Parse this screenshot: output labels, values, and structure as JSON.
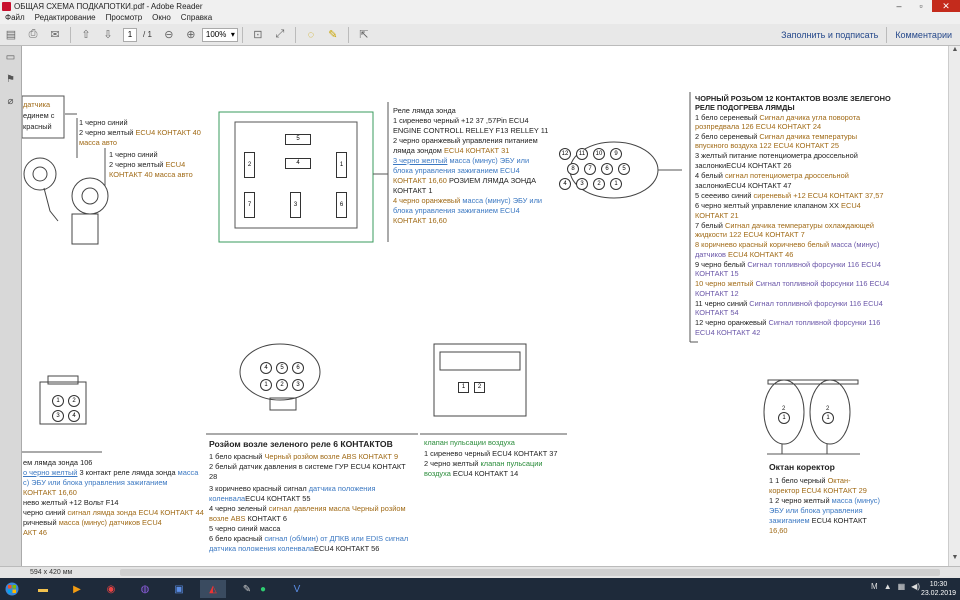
{
  "window": {
    "title": "ОБЩАЯ СХЕМА ПОДКАПОТКИ.pdf - Adobe Reader"
  },
  "menu": [
    "Файл",
    "Редактирование",
    "Просмотр",
    "Окно",
    "Справка"
  ],
  "toolbar": {
    "page_current": "1",
    "page_total": "/ 1",
    "zoom": "100%",
    "fill_sign": "Заполнить и подписать",
    "comments": "Комментарии"
  },
  "status": {
    "page_size": "594 x 420 мм"
  },
  "clock": {
    "time": "10:30",
    "date": "23.02.2019"
  },
  "doc": {
    "tl_box": {
      "l1": "датчика",
      "l2": "единем с",
      "l3": "красный"
    },
    "tl_a": {
      "l1": "1 черно синий",
      "l2a": "2 черно желтый ",
      "l2b": "ECU4 КОНТАКТ 40",
      "l3": "масса авто"
    },
    "tl_b": {
      "l1": "1 черно синий",
      "l2a": "2 черно желтый ",
      "l2b": "ECU4",
      "l3a": "КОНТАКТ 40 ",
      "l3b": "масса авто"
    },
    "rel6": {
      "pins": [
        "5",
        "2",
        "4",
        "1",
        "7",
        "3",
        "6"
      ]
    },
    "lambda": {
      "l1": "Реле лямда зонда",
      "l2": "1  сиренево черный  +12 37 ,57Pin ECU4",
      "l3": "ENGINE CONTROLL RELLEY F13 RELLEY 11",
      "l4": "2 черно оранжевый управления питанием",
      "l5a": "лямда зондом ",
      "l5b": "ECU4 КОНТАКТ 31",
      "l6a": "3 черно желтый",
      "l6b": "  масса (минус) ЭБУ или",
      "l7": "блока управления зажиганием ECU4",
      "l8a": "КОНТАКТ 16,60 ",
      "l8b": "РОЗИЕМ ЛЯМДА ЗОНДА",
      "l9": "КОНТАКТ 1",
      "l10a": "4 черно оранжевый ",
      "l10b": "масса (минус) ЭБУ или",
      "l11": "блока управления зажиганием ECU4",
      "l12": "КОНТАКТ 16,60"
    },
    "conn12": {
      "top": [
        "12",
        "11",
        "10",
        "9"
      ],
      "mid": [
        "8",
        "7",
        "6",
        "5"
      ],
      "bot": [
        "4",
        "3",
        "2",
        "1"
      ]
    },
    "black12": {
      "h1": "ЧОРНЫЙ РОЗЬОМ 12 КОНТАКТОВ ВОЗЛЕ ЗЕЛЕГОНО",
      "h2": "РЕЛЕ ПОДОГРЕВА ЛЯМДЫ",
      "r1a": "1 бело сереневый ",
      "r1b": "Сигнал дачика угла поворота",
      "r1c": "розпредвала 126 ECU4 КОНТАКТ 24",
      "r2a": "2 бело сереневый ",
      "r2b": "Сигнал дачика температуры",
      "r2c": "впускного воздуха 122 ECU4 КОНТАКТ 25",
      "r3a": "3 желтый ",
      "r3b": "питание потенциометра дроссельной",
      "r3c": "заслонкиECU4 КОНТАКТ  26",
      "r4a": "4 белый ",
      "r4b": "сигнал потенциометра дроссельной",
      "r4c": "заслонкиECU4 КОНТАКТ  47",
      "r5a": "5 сеееиво синий ",
      "r5b": "сиреневый +12 ECU4 КОНТАКТ 37,57",
      "r6a": "6 черно желтый ",
      "r6b": "управление клапаном ХХ ",
      "r6c": "ECU4",
      "r6d": "КОНТАКТ 21",
      "r7a": "7 белый ",
      "r7b": "Сигнал дачика температуры охлаждающей",
      "r7c": "жидкости 122 ECU4 КОНТАКТ 7",
      "r8a": "8 коричнево красный ",
      "r8b": "коричнево белый ",
      "r8c": "масса (минус)",
      "r8d": "датчиков ",
      "r8e": "ECU4 КОНТАКТ 46",
      "r9a": "9 черно белый ",
      "r9b": "Сигнал  топливной форсунки 116 ECU4",
      "r9c": "КОНТАКТ 15",
      "r10a": "10 черно желтый ",
      "r10b": "Сигнал  топливной форсунки 116 ECU4",
      "r10c": "КОНТАКТ 12",
      "r11a": "11 черно синий ",
      "r11b": "Сигнал  топливной форсунки 116 ECU4",
      "r11c": "КОНТАКТ 54",
      "r12a": "12 черно оранжевый ",
      "r12b": "Сигнал  топливной форсунки 116",
      "r12c": "ECU4 КОНТАКТ 42"
    },
    "bl_conn": {
      "pins": [
        "1",
        "2",
        "3",
        "4"
      ]
    },
    "bl_text": {
      "l1": "ем лямда зонда 106",
      "l2a": "о черно желтый",
      "l2b": " 3 контакт реле лямда зонда ",
      "l2c": "масса",
      "l3": "с) ЭБУ или блока управления зажиганием",
      "l4": "КОНТАКТ 16,60",
      "l5": "невo желтый +12 Вольт F14",
      "l6a": "черно синий  ",
      "l6b": "сигнал лямда зонда ECU4 КОНТАКТ 44",
      "l7a": "ричневый ",
      "l7b": "масса (минус) датчиков ECU4",
      "l8": "АКТ 46"
    },
    "mid6_conn": {
      "top": [
        "4",
        "5",
        "6"
      ],
      "bot": [
        "1",
        "2",
        "3"
      ]
    },
    "mid6": {
      "h": "Розйом возле зеленого реле 6 КОНТАКТОВ",
      "l1a": "1 бело красный ",
      "l1b": "Черный розйом возле ABS КОНТАКТ  9",
      "l2": "2 белый датчик давления в системе ГУР ECU4 КОНТАКТ",
      "l3": "28",
      "l4a": "3 коричнево красный сигнал ",
      "l4b": "датчика положения",
      "l5a": "коленвала",
      "l5b": "ECU4 КОНТАКТ  55",
      "l6a": "4 черно зеленый ",
      "l6b": "сигнал давления масла Черный розйом",
      "l7a": "возле ABS ",
      "l7b": " КОНТАКТ 6",
      "l8": "5 черно синий масса",
      "l9a": "6 бело красный ",
      "l9b": "сигнал (об/мин) от ДПКВ или EDIS сигнал",
      "l10a": "датчика положения коленвала",
      "l10b": "ECU4 КОНТАКТ  56"
    },
    "valve_conn": {
      "pins": [
        "1",
        "2"
      ]
    },
    "valve": {
      "h": "клапан пульсации воздуха",
      "l1": "1 сиреневo черный ECU4 КОНТАКТ  37",
      "l2a": " 2 черно желтый ",
      "l2b": "клапан пульсации",
      "l3a": "воздуха ",
      "l3b": "ECU4 КОНТАКТ 14"
    },
    "octane_conn": {
      "a": [
        "2",
        "1"
      ],
      "b": [
        "2",
        "1"
      ]
    },
    "octane": {
      "h": "Октан коректор",
      "l1a": "1  1 бело черный  ",
      "l1b": "Октан-",
      "l2": "коректор ECU4 КОНТАКТ 29",
      "l3a": "1 2 черно желтый ",
      "l3b": "масса (минус)",
      "l4": "ЭБУ или блока управления",
      "l5a": "зажиганием ",
      "l5b": "ECU4 КОНТАКТ",
      "l6": "16,60"
    }
  }
}
